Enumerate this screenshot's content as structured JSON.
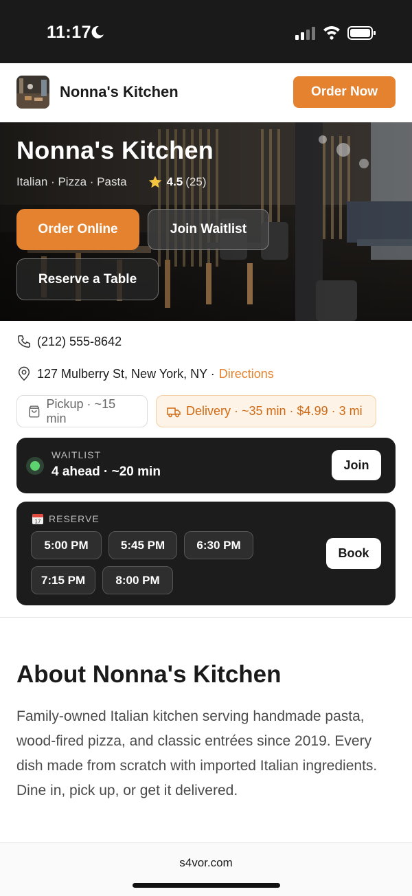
{
  "status_bar": {
    "time": "11:17"
  },
  "top_nav": {
    "brand": "Nonna's Kitchen",
    "order_now_label": "Order Now"
  },
  "hero": {
    "title": "Nonna's Kitchen",
    "cuisines": "Italian · Pizza · Pasta",
    "rating": "4.5",
    "review_count": "(25)",
    "buttons": {
      "order_online": "Order Online",
      "join_waitlist": "Join Waitlist",
      "reserve_table": "Reserve a Table"
    }
  },
  "contact": {
    "phone": "(212) 555-8642",
    "address": "127 Mulberry St, New York, NY ·",
    "directions_label": "Directions"
  },
  "service_chips": {
    "pickup": "Pickup · ~15 min",
    "delivery": "Delivery · ~35 min · $4.99 · 3 mi"
  },
  "waitlist": {
    "label": "WAITLIST",
    "status": "4 ahead · ~20 min",
    "join_label": "Join"
  },
  "reserve": {
    "label": "RESERVE",
    "slots": [
      "5:00 PM",
      "5:45 PM",
      "6:30 PM",
      "7:15 PM",
      "8:00 PM"
    ],
    "book_label": "Book"
  },
  "about": {
    "title": "About Nonna's Kitchen",
    "text": "Family-owned Italian kitchen serving handmade pasta, wood-fired pizza, and classic entrées since 2019. Every dish made from scratch with imported Italian ingredients. Dine in, pick up, or get it delivered."
  },
  "footer": {
    "domain": "s4vor.com"
  },
  "colors": {
    "accent": "#e5822f",
    "dark_card": "#1c1c1c",
    "status_green": "#5dd36f"
  }
}
